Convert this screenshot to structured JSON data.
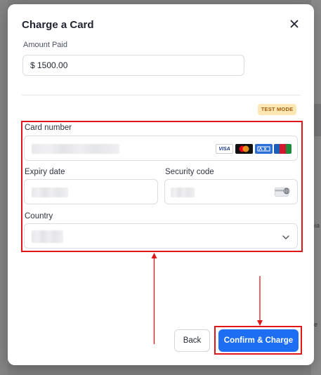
{
  "modal": {
    "title": "Charge a Card",
    "close_icon": "close-icon"
  },
  "amount": {
    "label": "Amount Paid",
    "value": "$ 1500.00"
  },
  "badge": {
    "text": "TEST MODE"
  },
  "card_form": {
    "card_number_label": "Card number",
    "expiry_label": "Expiry date",
    "security_label": "Security code",
    "country_label": "Country",
    "card_brands": [
      "VISA",
      "Mastercard",
      "AMEX",
      "JCB"
    ]
  },
  "buttons": {
    "back_label": "Back",
    "confirm_label": "Confirm & Charge"
  },
  "background": {
    "fragment_1": "nia",
    "fragment_2": "lle"
  },
  "colors": {
    "accent": "#1d6ef2",
    "annotation": "#e0161b",
    "badge_bg": "#fde7b4",
    "badge_text": "#a75c0c"
  }
}
